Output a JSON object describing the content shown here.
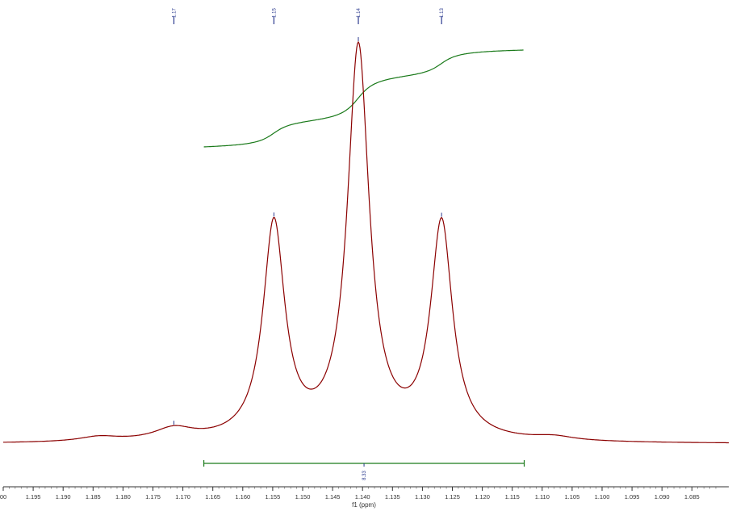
{
  "chart_data": {
    "type": "line",
    "xlabel": "f1 (ppm)",
    "x_reversed": true,
    "xlim": [
      1.2,
      1.08
    ],
    "x_ticks": [
      "00",
      "1.195",
      "1.190",
      "1.185",
      "1.180",
      "1.175",
      "1.170",
      "1.165",
      "1.160",
      "1.155",
      "1.150",
      "1.145",
      "1.140",
      "1.135",
      "1.130",
      "1.125",
      "1.120",
      "1.115",
      "1.110",
      "1.105",
      "1.100",
      "1.095",
      "1.090",
      "1.085"
    ],
    "x_tick_values": [
      1.2,
      1.195,
      1.19,
      1.185,
      1.18,
      1.175,
      1.17,
      1.165,
      1.16,
      1.155,
      1.15,
      1.145,
      1.14,
      1.135,
      1.13,
      1.125,
      1.12,
      1.115,
      1.11,
      1.105,
      1.1,
      1.095,
      1.09,
      1.085
    ],
    "peak_labels": [
      {
        "label": "1.17",
        "ppm": 1.1715
      },
      {
        "label": "1.15",
        "ppm": 1.1548
      },
      {
        "label": "1.14",
        "ppm": 1.1407
      },
      {
        "label": "1.13",
        "ppm": 1.1268
      }
    ],
    "spectrum": {
      "color": "#8b0000",
      "baseline": 0.0,
      "peaks": [
        {
          "ppm": 1.1548,
          "height": 0.55
        },
        {
          "ppm": 1.1407,
          "height": 1.0
        },
        {
          "ppm": 1.1268,
          "height": 0.55
        }
      ],
      "small_bumps": [
        {
          "ppm": 1.184,
          "height": 0.012
        },
        {
          "ppm": 1.1715,
          "height": 0.03
        },
        {
          "ppm": 1.108,
          "height": 0.01
        }
      ]
    },
    "integral": {
      "color": "#1a7a1a",
      "from": 1.1665,
      "to": 1.113,
      "value": "8.33"
    }
  }
}
